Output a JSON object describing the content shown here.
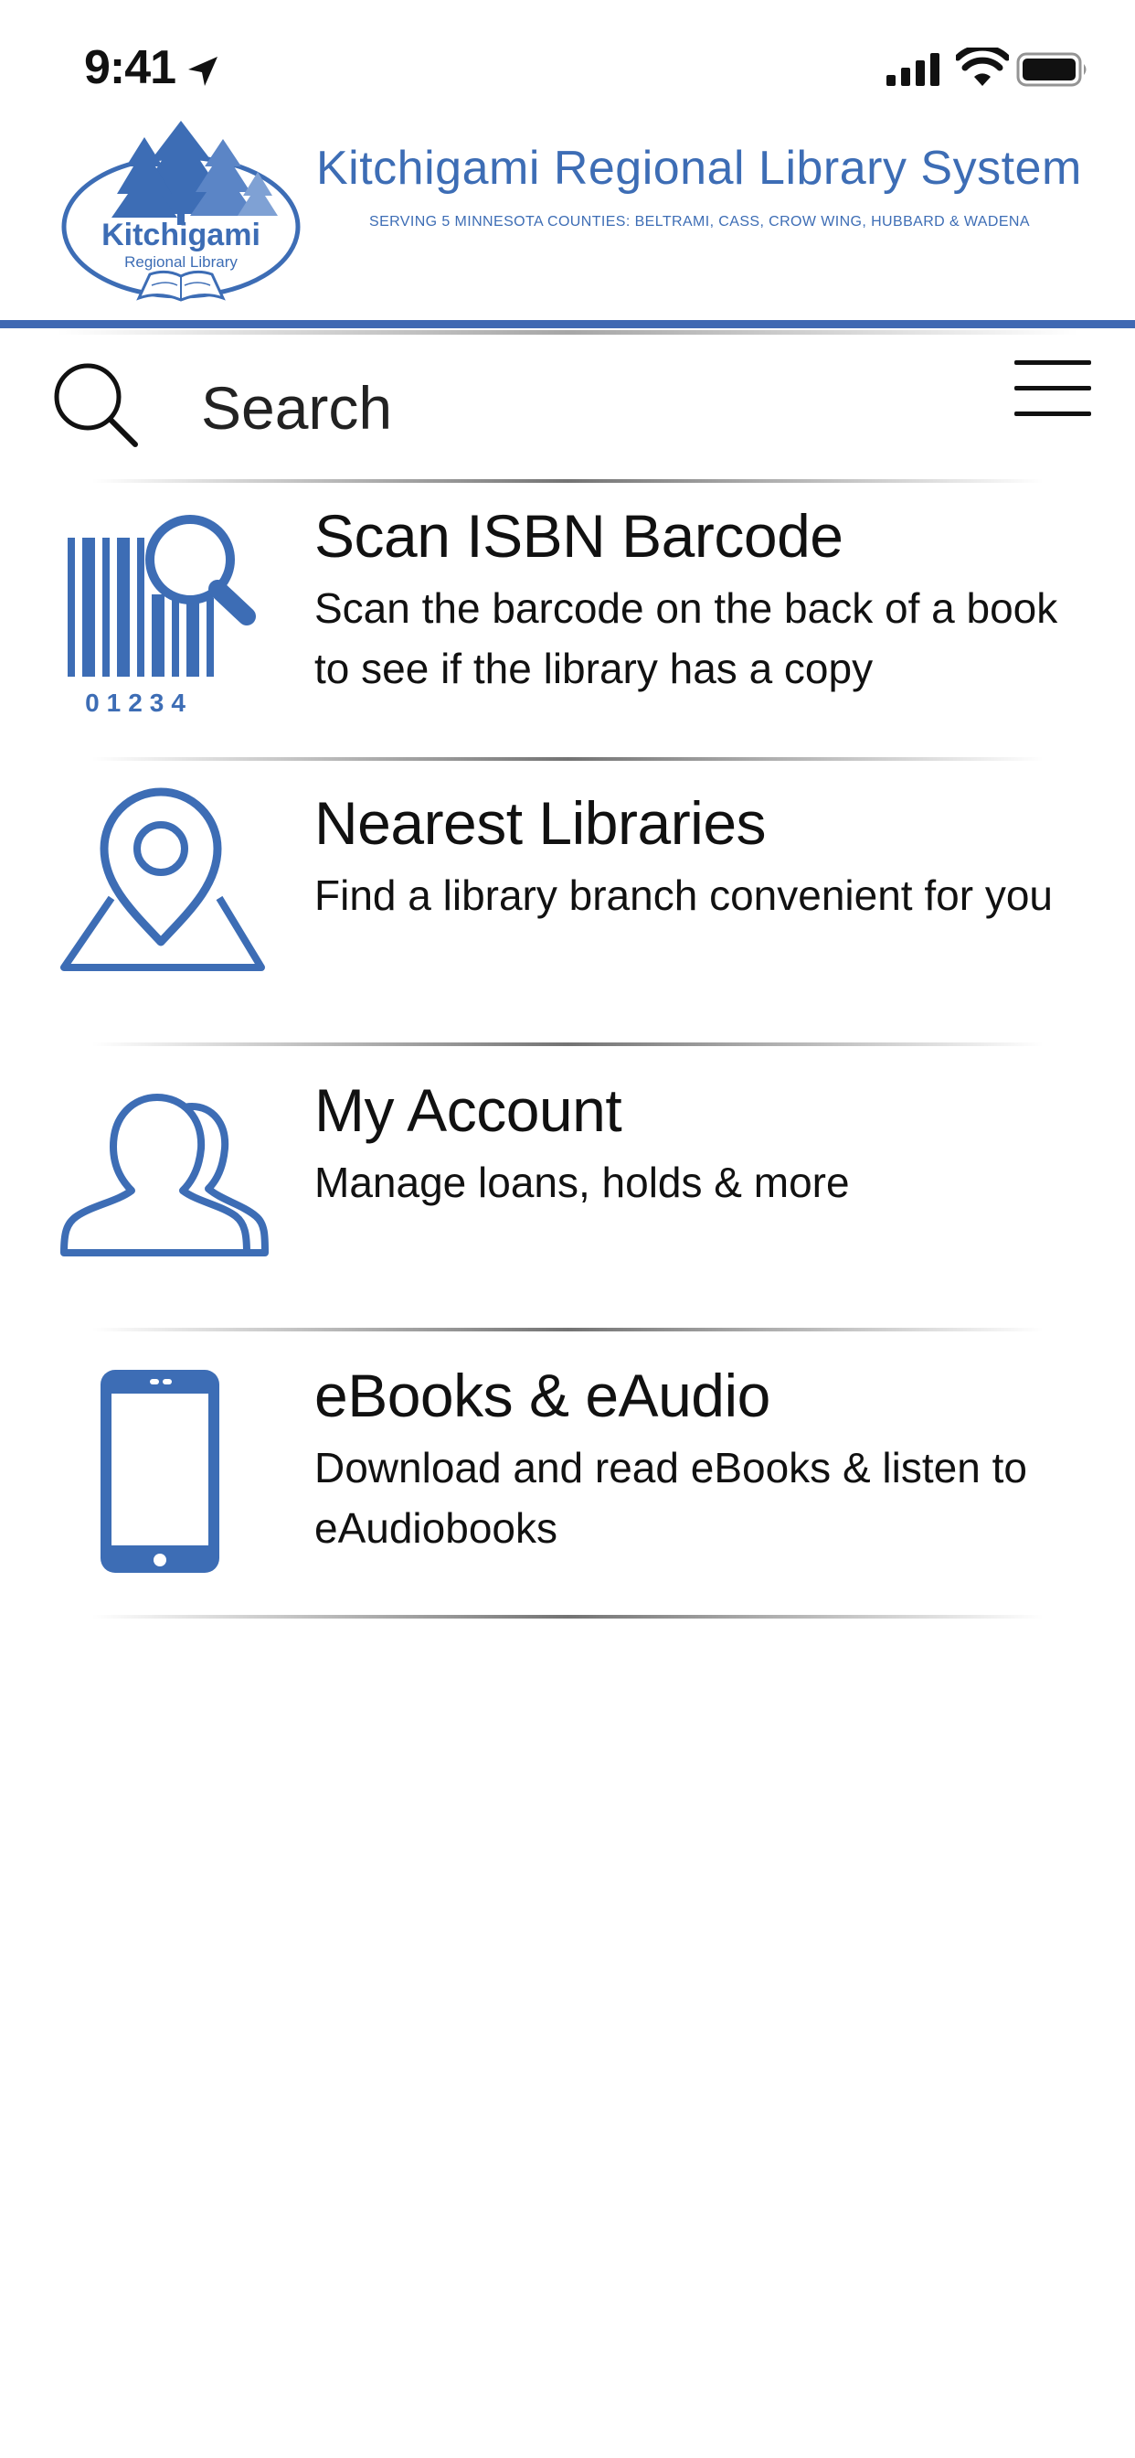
{
  "status_bar": {
    "time": "9:41",
    "icons": [
      "location-arrow-icon",
      "cellular-signal-icon",
      "wifi-icon",
      "battery-icon"
    ]
  },
  "header": {
    "logo": {
      "name": "Kitchigami",
      "tagline": "Regional Library"
    },
    "title": "Kitchigami Regional Library System",
    "subtitle": "SERVING 5 MINNESOTA COUNTIES: BELTRAMI, CASS, CROW WING, HUBBARD & WADENA"
  },
  "search": {
    "placeholder": "Search",
    "icons": [
      "search-icon",
      "hamburger-menu-icon"
    ]
  },
  "menu_items": [
    {
      "title": "Scan ISBN Barcode",
      "description": "Scan the barcode on the back of a book to see if the library has a copy",
      "icon": "barcode-scan-icon",
      "barcode_digits": "01234"
    },
    {
      "title": "Nearest Libraries",
      "description": "Find a library branch convenient for you",
      "icon": "map-pin-icon"
    },
    {
      "title": "My Account",
      "description": "Manage loans, holds & more",
      "icon": "users-icon"
    },
    {
      "title": "eBooks & eAudio",
      "description": "Download and read eBooks & listen to eAudiobooks",
      "icon": "smartphone-icon"
    }
  ],
  "colors": {
    "brand_blue": "#3d6db5",
    "header_rule": "#3f69b3",
    "text": "#111111",
    "background": "#ffffff"
  }
}
